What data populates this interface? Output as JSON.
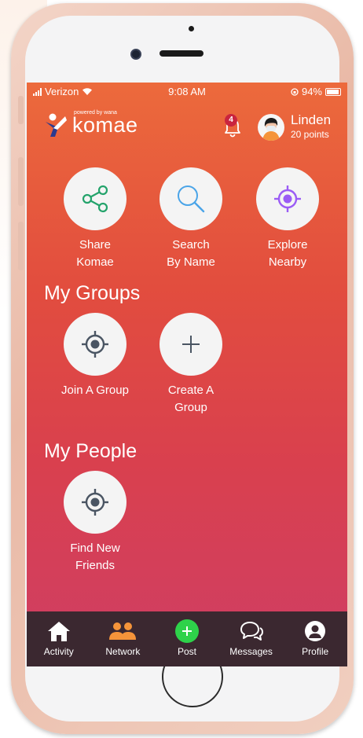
{
  "status_bar": {
    "carrier": "Verizon",
    "time": "9:08 AM",
    "battery": "94%",
    "battery_level": 0.94
  },
  "header": {
    "logo_powered": "powered by wana",
    "logo_text": "komae",
    "notification_count": "4",
    "user_name": "Linden",
    "user_points": "20 points"
  },
  "actions": [
    {
      "line1": "Share",
      "line2": "Komae",
      "icon": "share-icon"
    },
    {
      "line1": "Search",
      "line2": "By Name",
      "icon": "search-icon"
    },
    {
      "line1": "Explore",
      "line2": "Nearby",
      "icon": "target-icon"
    }
  ],
  "groups": {
    "title": "My Groups",
    "items": [
      {
        "line1": "Join A Group",
        "line2": "",
        "icon": "target-icon"
      },
      {
        "line1": "Create A",
        "line2": "Group",
        "icon": "plus-icon"
      }
    ]
  },
  "people": {
    "title": "My People",
    "items": [
      {
        "line1": "Find New",
        "line2": "Friends",
        "icon": "target-icon"
      }
    ]
  },
  "tabbar": [
    {
      "label": "Activity",
      "icon": "home-icon"
    },
    {
      "label": "Network",
      "icon": "people-icon"
    },
    {
      "label": "Post",
      "icon": "plus-icon"
    },
    {
      "label": "Messages",
      "icon": "chat-icon"
    },
    {
      "label": "Profile",
      "icon": "user-icon"
    }
  ],
  "colors": {
    "gradient_top": "#ec6a3c",
    "gradient_bottom": "#cf3e64",
    "tabbar_bg": "#3b2830",
    "accent_green": "#2ed24a",
    "accent_purple": "#9b5cf5",
    "accent_orange": "#f5943a"
  }
}
